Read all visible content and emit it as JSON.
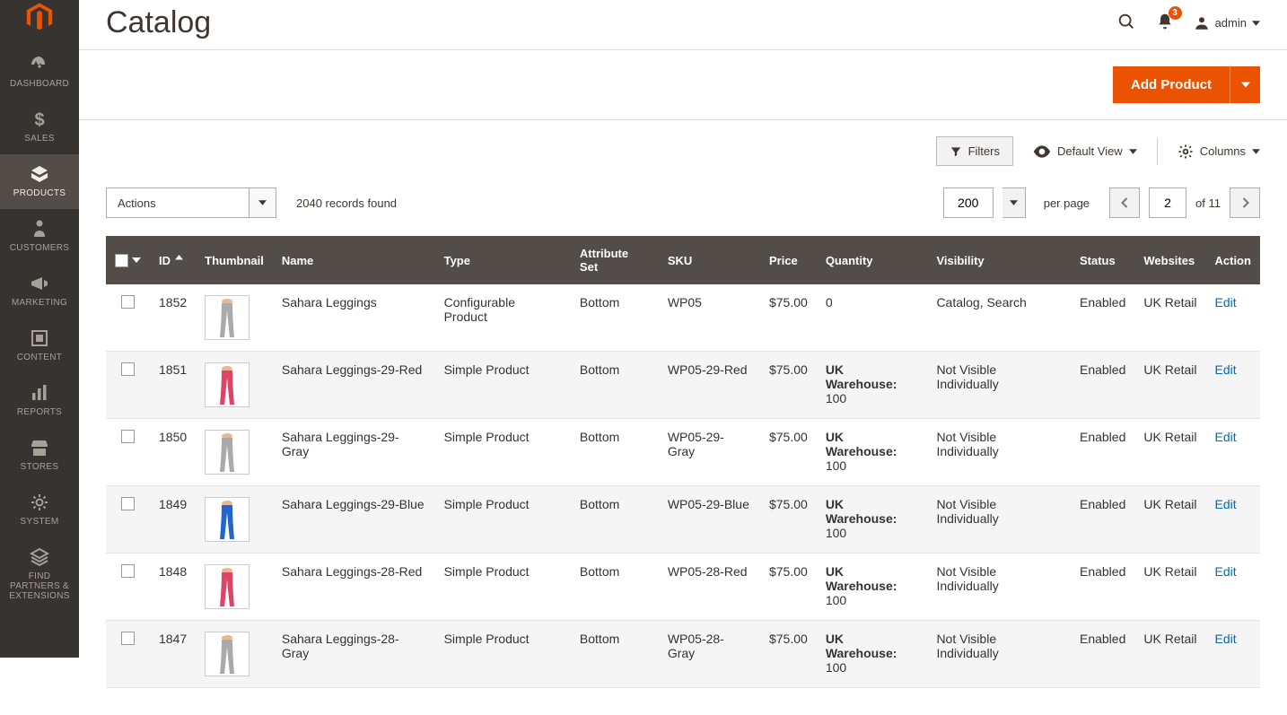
{
  "sidebar": {
    "items": [
      {
        "label": "Dashboard",
        "icon": "dashboard"
      },
      {
        "label": "Sales",
        "icon": "sales"
      },
      {
        "label": "Products",
        "icon": "products",
        "active": true
      },
      {
        "label": "Customers",
        "icon": "customers"
      },
      {
        "label": "Marketing",
        "icon": "marketing"
      },
      {
        "label": "Content",
        "icon": "content"
      },
      {
        "label": "Reports",
        "icon": "reports"
      },
      {
        "label": "Stores",
        "icon": "stores"
      },
      {
        "label": "System",
        "icon": "system"
      },
      {
        "label": "Find Partners & Extensions",
        "icon": "partners"
      }
    ]
  },
  "header": {
    "title": "Catalog",
    "notification_count": "3",
    "username": "admin"
  },
  "addbar": {
    "add_product_label": "Add Product"
  },
  "controls": {
    "filters_label": "Filters",
    "view_label": "Default View",
    "columns_label": "Columns",
    "actions_label": "Actions",
    "records_found": "2040 records found",
    "per_page_value": "200",
    "per_page_label": "per page",
    "current_page": "2",
    "total_pages": "of 11"
  },
  "table": {
    "columns": [
      "ID",
      "Thumbnail",
      "Name",
      "Type",
      "Attribute Set",
      "SKU",
      "Price",
      "Quantity",
      "Visibility",
      "Status",
      "Websites",
      "Action"
    ],
    "rows": [
      {
        "id": "1852",
        "name": "Sahara Leggings",
        "type": "Configurable Product",
        "attr": "Bottom",
        "sku": "WP05",
        "price": "$75.00",
        "qty_label": "",
        "qty_val": "0",
        "visibility": "Catalog, Search",
        "status": "Enabled",
        "websites": "UK Retail",
        "action": "Edit",
        "color": "#aaa"
      },
      {
        "id": "1851",
        "name": "Sahara Leggings-29-Red",
        "type": "Simple Product",
        "attr": "Bottom",
        "sku": "WP05-29-Red",
        "price": "$75.00",
        "qty_label": "UK Warehouse:",
        "qty_val": "100",
        "visibility": "Not Visible Individually",
        "status": "Enabled",
        "websites": "UK Retail",
        "action": "Edit",
        "color": "#d46"
      },
      {
        "id": "1850",
        "name": "Sahara Leggings-29-Gray",
        "type": "Simple Product",
        "attr": "Bottom",
        "sku": "WP05-29-Gray",
        "price": "$75.00",
        "qty_label": "UK Warehouse:",
        "qty_val": "100",
        "visibility": "Not Visible Individually",
        "status": "Enabled",
        "websites": "UK Retail",
        "action": "Edit",
        "color": "#aaa"
      },
      {
        "id": "1849",
        "name": "Sahara Leggings-29-Blue",
        "type": "Simple Product",
        "attr": "Bottom",
        "sku": "WP05-29-Blue",
        "price": "$75.00",
        "qty_label": "UK Warehouse:",
        "qty_val": "100",
        "visibility": "Not Visible Individually",
        "status": "Enabled",
        "websites": "UK Retail",
        "action": "Edit",
        "color": "#26c"
      },
      {
        "id": "1848",
        "name": "Sahara Leggings-28-Red",
        "type": "Simple Product",
        "attr": "Bottom",
        "sku": "WP05-28-Red",
        "price": "$75.00",
        "qty_label": "UK Warehouse:",
        "qty_val": "100",
        "visibility": "Not Visible Individually",
        "status": "Enabled",
        "websites": "UK Retail",
        "action": "Edit",
        "color": "#d46"
      },
      {
        "id": "1847",
        "name": "Sahara Leggings-28-Gray",
        "type": "Simple Product",
        "attr": "Bottom",
        "sku": "WP05-28-Gray",
        "price": "$75.00",
        "qty_label": "UK Warehouse:",
        "qty_val": "100",
        "visibility": "Not Visible Individually",
        "status": "Enabled",
        "websites": "UK Retail",
        "action": "Edit",
        "color": "#aaa"
      }
    ]
  }
}
